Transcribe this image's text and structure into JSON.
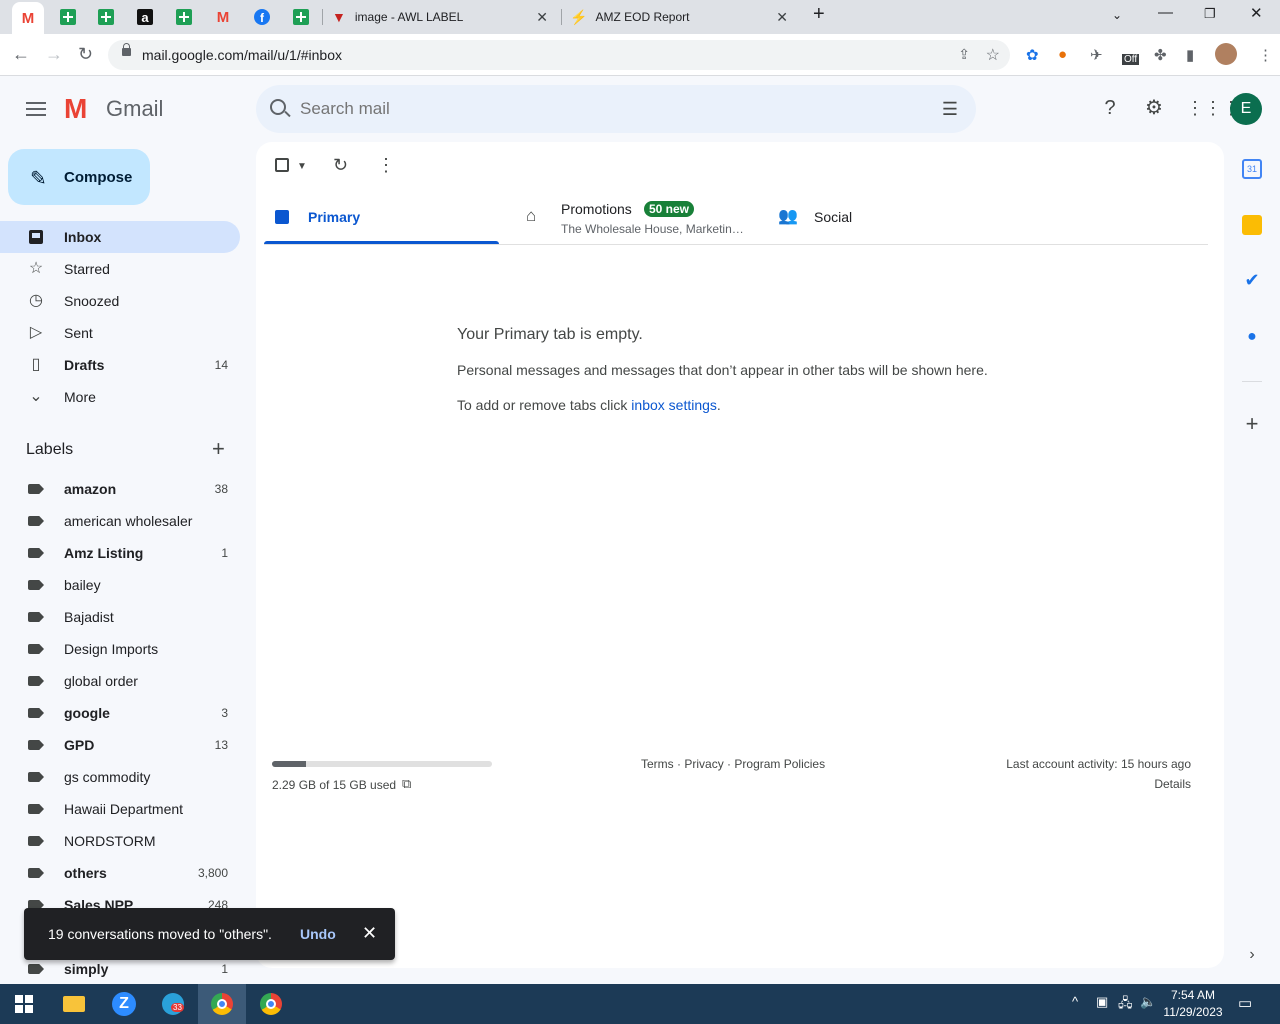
{
  "browser": {
    "tabs": [
      {
        "icon": "gmail-icon"
      },
      {
        "icon": "sheets-icon"
      },
      {
        "icon": "sheets-icon"
      },
      {
        "icon": "amazon-icon"
      },
      {
        "icon": "sheets-icon"
      },
      {
        "icon": "gmail-icon"
      },
      {
        "icon": "facebook-icon"
      },
      {
        "icon": "sheets-icon"
      },
      {
        "icon": "awl-icon",
        "title": "image - AWL LABEL"
      },
      {
        "icon": "amz-icon",
        "title": "AMZ EOD Report"
      }
    ],
    "url": "mail.google.com/mail/u/1/#inbox",
    "extension_badge": "Off"
  },
  "gmail": {
    "logo_text": "Gmail",
    "search_placeholder": "Search mail",
    "avatar_letter": "E",
    "compose_label": "Compose",
    "nav": [
      {
        "label": "Inbox",
        "count": ""
      },
      {
        "label": "Starred",
        "count": ""
      },
      {
        "label": "Snoozed",
        "count": ""
      },
      {
        "label": "Sent",
        "count": ""
      },
      {
        "label": "Drafts",
        "count": "14"
      },
      {
        "label": "More",
        "count": ""
      }
    ],
    "labels_header": "Labels",
    "labels": [
      {
        "name": "amazon",
        "count": "38",
        "bold": true
      },
      {
        "name": "american wholesaler",
        "count": "",
        "bold": false
      },
      {
        "name": "Amz Listing",
        "count": "1",
        "bold": true
      },
      {
        "name": "bailey",
        "count": "",
        "bold": false
      },
      {
        "name": "Bajadist",
        "count": "",
        "bold": false
      },
      {
        "name": "Design Imports",
        "count": "",
        "bold": false
      },
      {
        "name": "global order",
        "count": "",
        "bold": false
      },
      {
        "name": "google",
        "count": "3",
        "bold": true
      },
      {
        "name": "GPD",
        "count": "13",
        "bold": true
      },
      {
        "name": "gs commodity",
        "count": "",
        "bold": false
      },
      {
        "name": "Hawaii Department",
        "count": "",
        "bold": false
      },
      {
        "name": "NORDSTORM",
        "count": "",
        "bold": false
      },
      {
        "name": "others",
        "count": "3,800",
        "bold": true
      },
      {
        "name": "Sales NPP",
        "count": "248",
        "bold": true
      },
      {
        "name": "",
        "count": "",
        "bold": false
      },
      {
        "name": "simply",
        "count": "1",
        "bold": true
      }
    ],
    "category_tabs": {
      "primary": "Primary",
      "promotions": "Promotions",
      "promotions_badge": "50 new",
      "promotions_snippet": "The Wholesale House, Marketin…",
      "social": "Social"
    },
    "empty_state": {
      "title": "Your Primary tab is empty.",
      "line1": "Personal messages and messages that don’t appear in other tabs will be shown here.",
      "line2_prefix": "To add or remove tabs click ",
      "line2_link": "inbox settings",
      "line2_suffix": "."
    },
    "footer": {
      "storage_text": "2.29 GB of 15 GB used",
      "storage_fraction": 0.153,
      "terms": "Terms",
      "privacy": "Privacy",
      "program_policies": "Program Policies",
      "sep": "·",
      "activity": "Last account activity: 15 hours ago",
      "details": "Details"
    },
    "toast": {
      "message": "19 conversations moved to \"others\".",
      "undo": "Undo"
    }
  },
  "taskbar": {
    "time": "7:54 AM",
    "date": "11/29/2023",
    "telegram_badge": "33"
  }
}
